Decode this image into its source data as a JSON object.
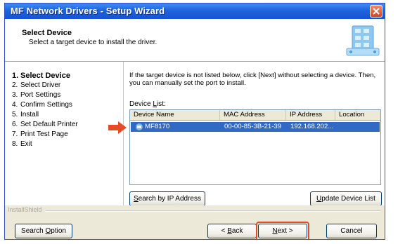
{
  "window": {
    "title": "MF Network Drivers - Setup Wizard"
  },
  "header": {
    "title": "Select Device",
    "subtitle": "Select a target device to install the driver."
  },
  "steps": [
    {
      "num": "1.",
      "label": "Select Device"
    },
    {
      "num": "2.",
      "label": "Select Driver"
    },
    {
      "num": "3.",
      "label": "Port Settings"
    },
    {
      "num": "4.",
      "label": "Confirm Settings"
    },
    {
      "num": "5.",
      "label": "Install"
    },
    {
      "num": "6.",
      "label": "Set Default Printer"
    },
    {
      "num": "7.",
      "label": "Print Test Page"
    },
    {
      "num": "8.",
      "label": "Exit"
    }
  ],
  "content": {
    "instruction_line1": "If the target device is not listed below, click [Next] without selecting a device. Then,",
    "instruction_line2": "you can manually set the port to install.",
    "device_list_prefix": "Device ",
    "device_list_hotkey": "L",
    "device_list_suffix": "ist:",
    "columns": [
      "Device Name",
      "MAC Address",
      "IP Address",
      "Location"
    ],
    "rows": [
      {
        "name": "MF8170",
        "mac": "00-00-85-3B-21-39",
        "ip": "192.168.202...",
        "location": ""
      }
    ]
  },
  "buttons": {
    "search_ip": {
      "hotkey": "S",
      "rest": "earch by IP Address"
    },
    "update": {
      "hotkey": "U",
      "rest": "pdate Device List"
    },
    "search_option": {
      "prefix": "Search ",
      "hotkey": "O",
      "rest": "ption"
    },
    "back": {
      "prefix": "< ",
      "hotkey": "B",
      "rest": "ack"
    },
    "next": {
      "hotkey": "N",
      "rest": "ext >"
    },
    "cancel": "Cancel"
  },
  "footer": {
    "brand": "InstallShield"
  },
  "colors": {
    "title_bar": "#1f63dc",
    "selection": "#316ac5",
    "highlight": "#e64b28"
  },
  "selected_row_index": 0
}
